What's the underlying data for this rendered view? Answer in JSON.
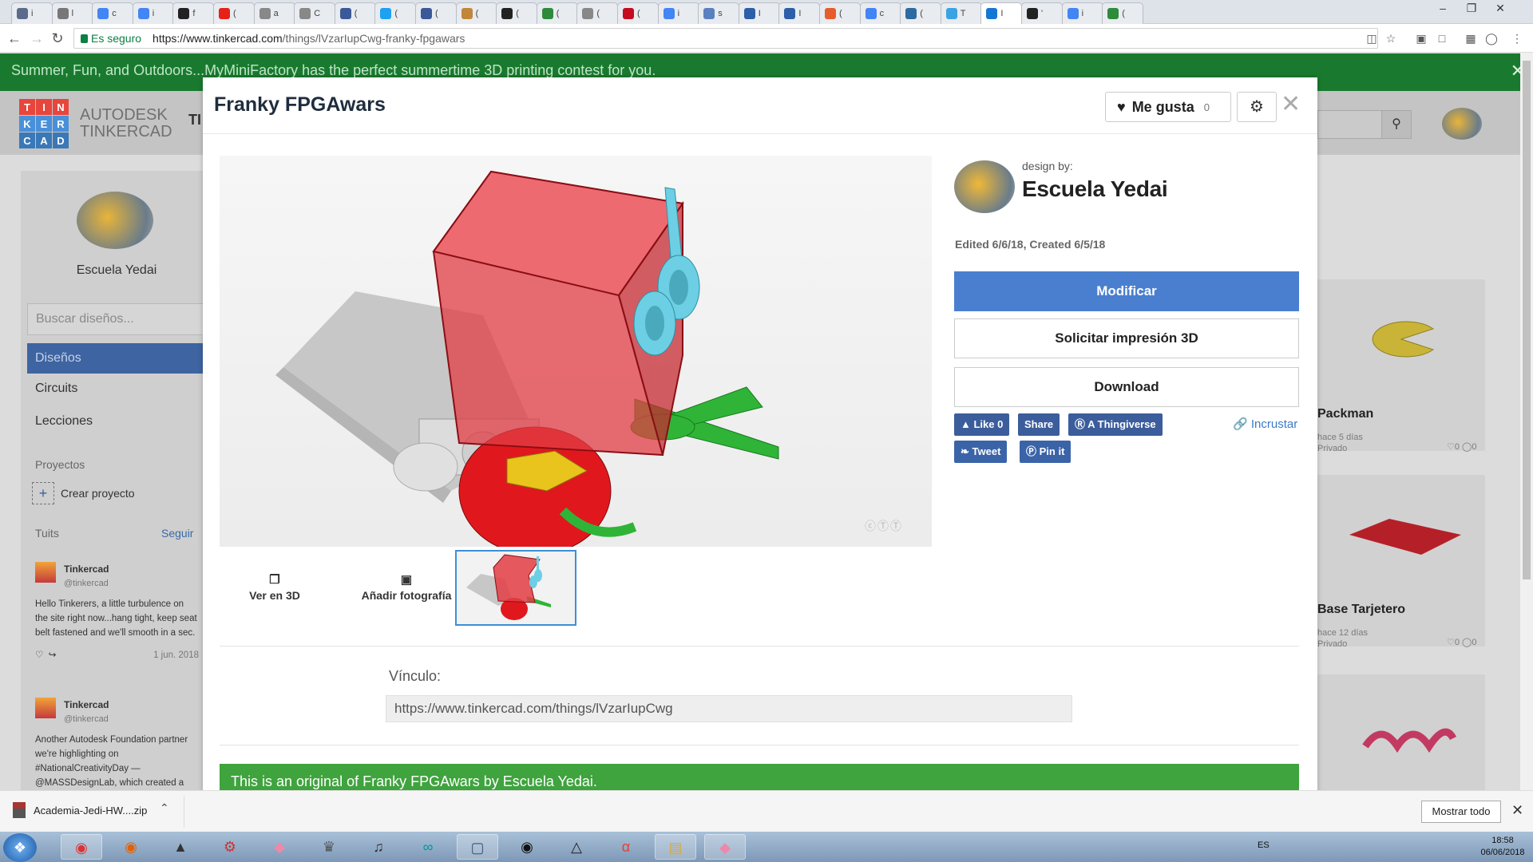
{
  "browser": {
    "tabs": [
      {
        "label": "i",
        "color": "#5a6b8c"
      },
      {
        "label": "l",
        "color": "#777777"
      },
      {
        "label": "c",
        "color": "#4285f4"
      },
      {
        "label": "i",
        "color": "#4285f4"
      },
      {
        "label": "f",
        "color": "#222222"
      },
      {
        "label": "(",
        "color": "#e62117"
      },
      {
        "label": "a",
        "color": "#888888"
      },
      {
        "label": "C",
        "color": "#888888"
      },
      {
        "label": "(",
        "color": "#3b5998"
      },
      {
        "label": "(",
        "color": "#1da1f2"
      },
      {
        "label": "(",
        "color": "#3b5998"
      },
      {
        "label": "(",
        "color": "#c0863a"
      },
      {
        "label": "(",
        "color": "#222222"
      },
      {
        "label": "(",
        "color": "#2e8b3b"
      },
      {
        "label": "(",
        "color": "#888888"
      },
      {
        "label": "(",
        "color": "#c60b1e"
      },
      {
        "label": "i",
        "color": "#4285f4"
      },
      {
        "label": "s",
        "color": "#5a80c0"
      },
      {
        "label": "I",
        "color": "#2c5fa8"
      },
      {
        "label": "I",
        "color": "#2c5fa8"
      },
      {
        "label": "(",
        "color": "#e65c2b"
      },
      {
        "label": "c",
        "color": "#4285f4"
      },
      {
        "label": "(",
        "color": "#2d6a9f"
      },
      {
        "label": "T",
        "color": "#3aa3e3"
      },
      {
        "label": "I",
        "color": "#1477d4"
      },
      {
        "label": "'",
        "color": "#222222"
      },
      {
        "label": "i",
        "color": "#4285f4"
      },
      {
        "label": "(",
        "color": "#2e8b3b"
      }
    ],
    "security_label": "Es seguro",
    "url_host": "https://www.tinkercad.com",
    "url_path": "/things/lVzarIupCwg-franky-fpgawars"
  },
  "banner": {
    "text": "Summer, Fun, and Outdoors...MyMiniFactory has the perfect summertime 3D printing contest for you."
  },
  "site": {
    "logo_letters": [
      "T",
      "I",
      "N",
      "K",
      "E",
      "R",
      "C",
      "A",
      "D"
    ],
    "logo_colors": [
      "#e8453c",
      "#e8453c",
      "#e8453c",
      "#4a90d9",
      "#4a90d9",
      "#4a90d9",
      "#3a78b8",
      "#3a78b8",
      "#3a78b8"
    ],
    "brand_top": "AUTODESK",
    "brand_bottom": "TINKERCAD",
    "header_partial": "TI"
  },
  "sidebar": {
    "user_name": "Escuela Yedai",
    "search_placeholder": "Buscar diseños...",
    "items": [
      {
        "label": "Diseños"
      },
      {
        "label": "Circuits"
      },
      {
        "label": "Lecciones"
      }
    ],
    "projects_label": "Proyectos",
    "create_project": "Crear proyecto",
    "tweets_label": "Tuits",
    "follow_label": "Seguir",
    "tweets": [
      {
        "name": "Tinkercad",
        "handle": "@tinkercad",
        "text": "Hello Tinkerers, a little turbulence on the site right now...hang tight, keep seat belt fastened and we'll smooth in a sec.",
        "date": "1 jun. 2018"
      },
      {
        "name": "Tinkercad",
        "handle": "@tinkercad",
        "text": "Another Autodesk Foundation partner we're highlighting on #NationalCreativityDay — @MASSDesignLab, which created a",
        "date": ""
      }
    ]
  },
  "right_cards": [
    {
      "title": "Packman",
      "time": "hace 5 días",
      "privacy": "Privado",
      "likes": "0",
      "comments": "0"
    },
    {
      "title": "Base Tarjetero",
      "time": "hace 12 días",
      "privacy": "Privado",
      "likes": "0",
      "comments": "0"
    }
  ],
  "modal": {
    "title": "Franky FPGAwars",
    "like_label": "Me gusta",
    "like_count": "0",
    "viewer_buttons": [
      {
        "label": "Ver en 3D",
        "icon": "cube-icon"
      },
      {
        "label": "Añadir fotografía",
        "icon": "image-icon"
      }
    ],
    "author": {
      "design_by": "design by:",
      "name": "Escuela Yedai"
    },
    "edited_text": "Edited 6/6/18, Created 6/5/18",
    "actions": {
      "modify": "Modificar",
      "print": "Solicitar impresión 3D",
      "download": "Download"
    },
    "social": {
      "like": "Like 0",
      "share": "Share",
      "thingiverse": "A Thingiverse",
      "embed": "Incrustar",
      "tweet": "Tweet",
      "pin": "Pin it"
    },
    "link_label": "Vínculo:",
    "link_value": "https://www.tinkercad.com/things/lVzarIupCwg",
    "original_text": "This is an original of Franky FPGAwars by Escuela Yedai."
  },
  "download_bar": {
    "file_name": "Academia-Jedi-HW....zip",
    "show_all": "Mostrar todo"
  },
  "taskbar": {
    "language": "ES",
    "time": "18:58",
    "date": "06/06/2018"
  },
  "colors": {
    "accent_blue": "#4a7fcf",
    "banner_green": "#197a2f",
    "original_green": "#3fa33e"
  }
}
